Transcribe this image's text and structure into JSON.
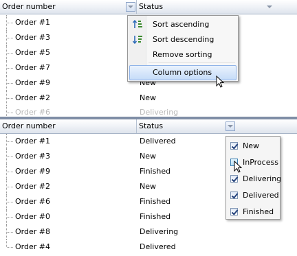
{
  "columns": {
    "order": "Order number",
    "status": "Status"
  },
  "top_panel": {
    "rows": [
      {
        "order": "Order #1",
        "status": ""
      },
      {
        "order": "Order #3",
        "status": ""
      },
      {
        "order": "Order #5",
        "status": ""
      },
      {
        "order": "Order #7",
        "status": ""
      },
      {
        "order": "Order #9",
        "status": "New"
      },
      {
        "order": "Order #2",
        "status": "New"
      },
      {
        "order": "Order #6",
        "status": "Delivering"
      }
    ],
    "context_menu": {
      "items": [
        {
          "label": "Sort ascending",
          "icon": "sort-ascending-icon"
        },
        {
          "label": "Sort descending",
          "icon": "sort-descending-icon"
        },
        {
          "label": "Remove sorting",
          "icon": ""
        },
        {
          "label": "Column options",
          "icon": ""
        }
      ]
    }
  },
  "bottom_panel": {
    "rows": [
      {
        "order": "Order #1",
        "status": "Delivered"
      },
      {
        "order": "Order #3",
        "status": "New"
      },
      {
        "order": "Order #9",
        "status": "Finished"
      },
      {
        "order": "Order #2",
        "status": "New"
      },
      {
        "order": "Order #6",
        "status": "Finished"
      },
      {
        "order": "Order #0",
        "status": "Finished"
      },
      {
        "order": "Order #8",
        "status": "Delivering"
      },
      {
        "order": "Order #4",
        "status": "Delivered"
      }
    ],
    "filter": {
      "options": [
        {
          "label": "New",
          "checked": true
        },
        {
          "label": "InProcess",
          "checked": false
        },
        {
          "label": "Delivering",
          "checked": true
        },
        {
          "label": "Delivered",
          "checked": true
        },
        {
          "label": "Finished",
          "checked": true
        }
      ]
    }
  },
  "colors": {
    "accent": "#c6dcf8",
    "header": "#eef1f6",
    "separator": "#7f8ea6"
  }
}
